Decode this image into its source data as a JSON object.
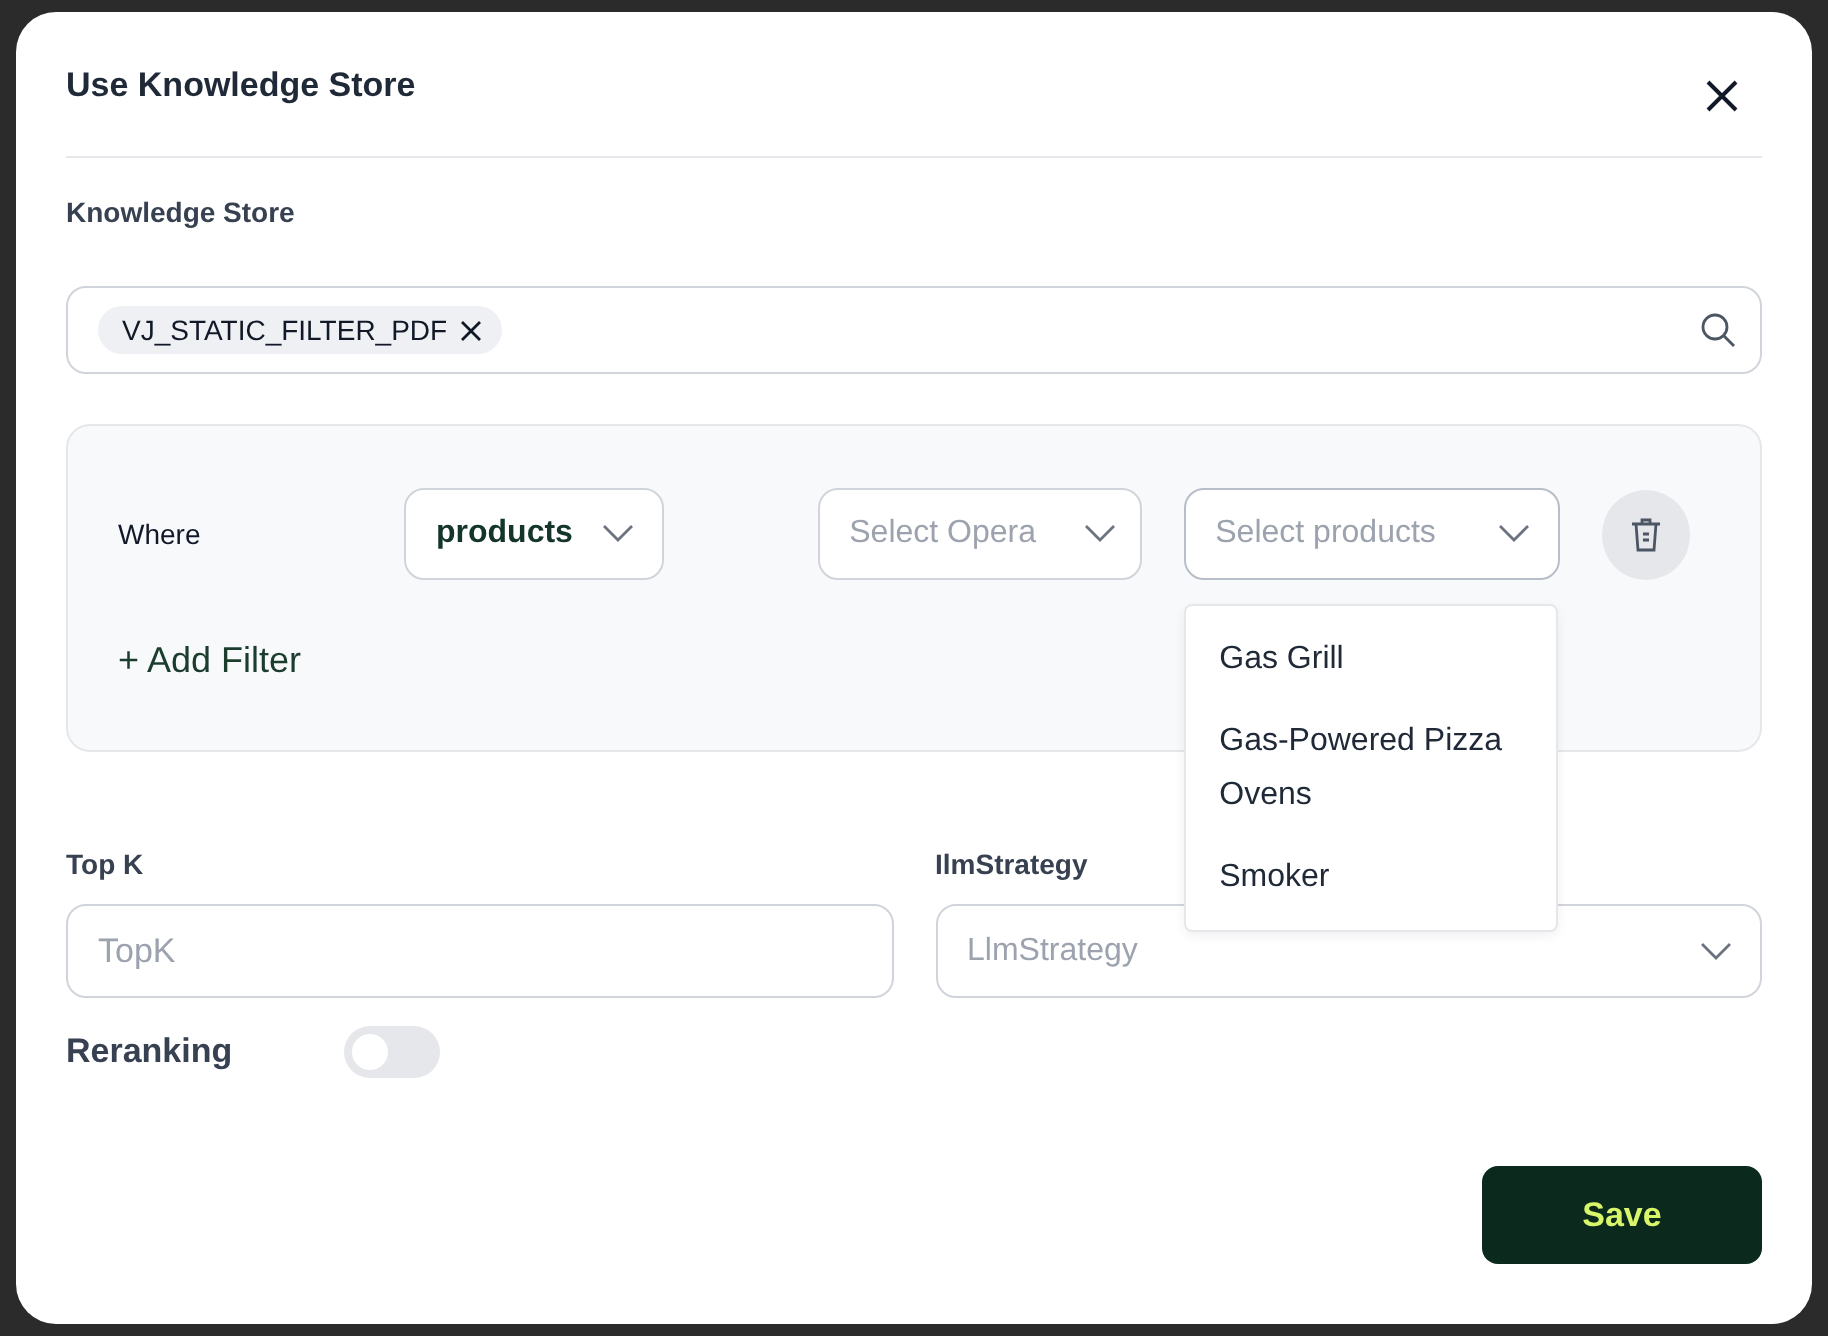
{
  "dialog": {
    "title": "Use Knowledge Store"
  },
  "knowledge_store": {
    "label": "Knowledge Store",
    "chips": [
      {
        "label": "VJ_STATIC_FILTER_PDF"
      }
    ]
  },
  "filters": {
    "rows": [
      {
        "label": "Where",
        "field": {
          "value": "products"
        },
        "operator": {
          "placeholder": "Select Opera"
        },
        "values": {
          "placeholder": "Select products",
          "expanded": true,
          "options": [
            {
              "label": "Gas Grill"
            },
            {
              "label": "Gas-Powered Pizza Ovens"
            },
            {
              "label": "Smoker"
            }
          ]
        }
      }
    ],
    "add_label": "+ Add Filter"
  },
  "top_k": {
    "label": "Top K",
    "placeholder": "TopK"
  },
  "llm_strategy": {
    "label": "IlmStrategy",
    "placeholder": "LlmStrategy"
  },
  "reranking": {
    "label": "Reranking",
    "on": false
  },
  "buttons": [
    {
      "label": "Save"
    }
  ]
}
